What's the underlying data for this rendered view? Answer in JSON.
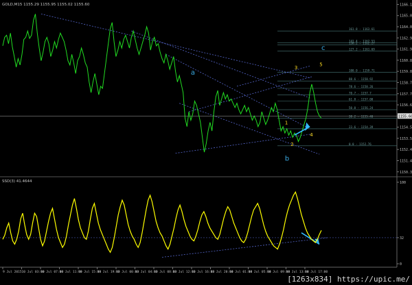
{
  "header": {
    "symbol_line": "GOLD,M15  1155.29  1155.95  1155.02  1155.60",
    "indicator_line": "SSD(3) 41.4644"
  },
  "chart_data": [
    {
      "type": "line",
      "title": "GOLD,M15",
      "ylim": [
        1150.4,
        1166.0
      ],
      "y_ticks": [
        "1166.10",
        "1165.05",
        "1164.00",
        "1162.95",
        "1161.90",
        "1160.85",
        "1159.80",
        "1158.75",
        "1157.70",
        "1156.65",
        "1155.60",
        "1154.55",
        "1153.50",
        "1152.45",
        "1151.40",
        "1150.35"
      ],
      "current_price": "1155.60",
      "x_tick_labels": [
        "9 Jul 2015",
        "10 Jul 03:00",
        "10 Jul 07:00",
        "10 Jul 11:00",
        "10 Jul 15:00",
        "10 Jul 19:00",
        "13 Jul 00:00",
        "13 Jul 04:00",
        "13 Jul 08:00",
        "13 Jul 12:00",
        "13 Jul 16:00",
        "13 Jul 20:00",
        "14 Jul 01:00",
        "14 Jul 05:00",
        "14 Jul 09:00",
        "14 Jul 13:00",
        "14 Jul 17:00"
      ],
      "price_series": [
        1162.2,
        1163.0,
        1163.2,
        1162.4,
        1163.4,
        1162.1,
        1161.2,
        1160.2,
        1161.0,
        1160.4,
        1161.4,
        1162.8,
        1163.0,
        1163.6,
        1162.9,
        1163.2,
        1164.6,
        1165.2,
        1163.4,
        1162.0,
        1160.8,
        1161.6,
        1162.6,
        1163.0,
        1162.4,
        1161.2,
        1161.8,
        1162.6,
        1162.0,
        1162.8,
        1163.4,
        1163.0,
        1162.6,
        1161.8,
        1160.8,
        1160.4,
        1161.4,
        1160.6,
        1159.6,
        1160.8,
        1161.2,
        1162.0,
        1161.4,
        1160.6,
        1160.2,
        1158.8,
        1157.8,
        1158.8,
        1159.6,
        1158.6,
        1157.6,
        1158.4,
        1158.2,
        1159.6,
        1161.0,
        1162.4,
        1163.8,
        1164.4,
        1162.6,
        1161.2,
        1161.8,
        1162.6,
        1162.0,
        1162.8,
        1163.2,
        1162.6,
        1162.0,
        1163.0,
        1163.6,
        1162.8,
        1162.0,
        1161.4,
        1162.0,
        1162.6,
        1163.2,
        1164.0,
        1163.4,
        1161.8,
        1162.6,
        1163.0,
        1162.2,
        1162.4,
        1161.6,
        1161.0,
        1160.6,
        1161.4,
        1160.8,
        1160.0,
        1160.6,
        1161.2,
        1159.8,
        1158.8,
        1159.4,
        1158.6,
        1157.8,
        1155.4,
        1154.6,
        1156.0,
        1155.2,
        1155.8,
        1157.0,
        1156.6,
        1155.8,
        1155.0,
        1153.6,
        1152.2,
        1153.0,
        1154.2,
        1155.0,
        1154.2,
        1156.0,
        1157.4,
        1158.0,
        1156.6,
        1157.2,
        1157.8,
        1157.2,
        1157.6,
        1157.0,
        1157.2,
        1156.8,
        1156.4,
        1156.8,
        1156.2,
        1155.8,
        1156.2,
        1156.6,
        1156.0,
        1156.4,
        1155.8,
        1155.2,
        1155.6,
        1155.2,
        1154.6,
        1155.0,
        1156.0,
        1155.4,
        1154.8,
        1155.2,
        1155.8,
        1156.4,
        1156.0,
        1156.8,
        1156.2,
        1155.2,
        1154.2,
        1154.6,
        1154.0,
        1154.4,
        1153.8,
        1154.2,
        1153.6,
        1154.0,
        1153.8,
        1153.2,
        1153.6,
        1154.2,
        1154.8,
        1155.4,
        1156.4,
        1157.8,
        1158.6,
        1157.8,
        1156.8,
        1156.0,
        1155.6,
        1155.4
      ]
    },
    {
      "type": "line",
      "title": "SSD(3) 41.4644",
      "ylim": [
        0,
        100
      ],
      "y_ticks": [
        "100",
        "32",
        "0"
      ],
      "level": 32,
      "value": 41.4644,
      "series": [
        30,
        35,
        44,
        50,
        38,
        28,
        24,
        30,
        40,
        55,
        62,
        48,
        36,
        30,
        36,
        50,
        62,
        58,
        44,
        30,
        22,
        28,
        40,
        52,
        62,
        68,
        55,
        42,
        32,
        26,
        20,
        24,
        34,
        48,
        60,
        72,
        80,
        68,
        54,
        44,
        38,
        32,
        30,
        40,
        55,
        68,
        74,
        62,
        50,
        42,
        36,
        30,
        24,
        18,
        14,
        20,
        32,
        46,
        60,
        70,
        78,
        72,
        60,
        48,
        40,
        34,
        30,
        24,
        20,
        26,
        38,
        52,
        66,
        78,
        84,
        76,
        64,
        52,
        44,
        38,
        34,
        28,
        22,
        18,
        24,
        34,
        44,
        56,
        66,
        72,
        64,
        54,
        46,
        40,
        34,
        30,
        28,
        34,
        42,
        52,
        60,
        64,
        58,
        50,
        44,
        40,
        36,
        32,
        30,
        36,
        46,
        56,
        64,
        70,
        66,
        58,
        50,
        44,
        38,
        32,
        28,
        26,
        30,
        38,
        48,
        58,
        66,
        70,
        74,
        68,
        58,
        48,
        40,
        34,
        30,
        26,
        22,
        20,
        18,
        24,
        32,
        42,
        54,
        64,
        72,
        78,
        84,
        88,
        80,
        70,
        60,
        52,
        44,
        38,
        34,
        30,
        28,
        26,
        30,
        36,
        41
      ]
    }
  ],
  "annotations": {
    "wave_a": "a",
    "wave_b": "b",
    "wave_c": "c",
    "wave_1": "1",
    "wave_2": "2",
    "wave_3": "3",
    "wave_4": "4",
    "wave_5": "5"
  },
  "fib_levels": [
    {
      "label": "161.8 - 1163.61",
      "price": 1163.6
    },
    {
      "label": "141.4 - 1162.53",
      "price": 1162.5
    },
    {
      "label": "138.2 - 1162.27",
      "price": 1162.3
    },
    {
      "label": "127.2 - 1161.69",
      "price": 1161.7
    },
    {
      "label": "100.0 - 1159.71",
      "price": 1159.7
    },
    {
      "label": "88.6 - 1158.92",
      "price": 1158.9
    },
    {
      "label": "78.6 - 1158.26",
      "price": 1158.2
    },
    {
      "label": "70.7 - 1157.7",
      "price": 1157.6
    },
    {
      "label": "61.8 - 1157.08",
      "price": 1157.0
    },
    {
      "label": "50.0 - 1156.24",
      "price": 1156.2
    },
    {
      "label": "38.2 - 1155.40",
      "price": 1155.4
    },
    {
      "label": "23.6 - 1154.39",
      "price": 1154.4
    },
    {
      "label": "0.0 - 1152.76",
      "price": 1152.8
    }
  ],
  "colors": {
    "background": "#000000",
    "price_line": "#22dd22",
    "oscillator": "#ffff00",
    "channel": "#5566cc",
    "arrow": "#33bbff",
    "label_blue": "#3aa8e0",
    "label_yellow": "#ffdd22",
    "fib": "#4a7a7a",
    "axis_text": "#c0c0c0"
  },
  "watermark": "[1263x834] https://upic.me/"
}
